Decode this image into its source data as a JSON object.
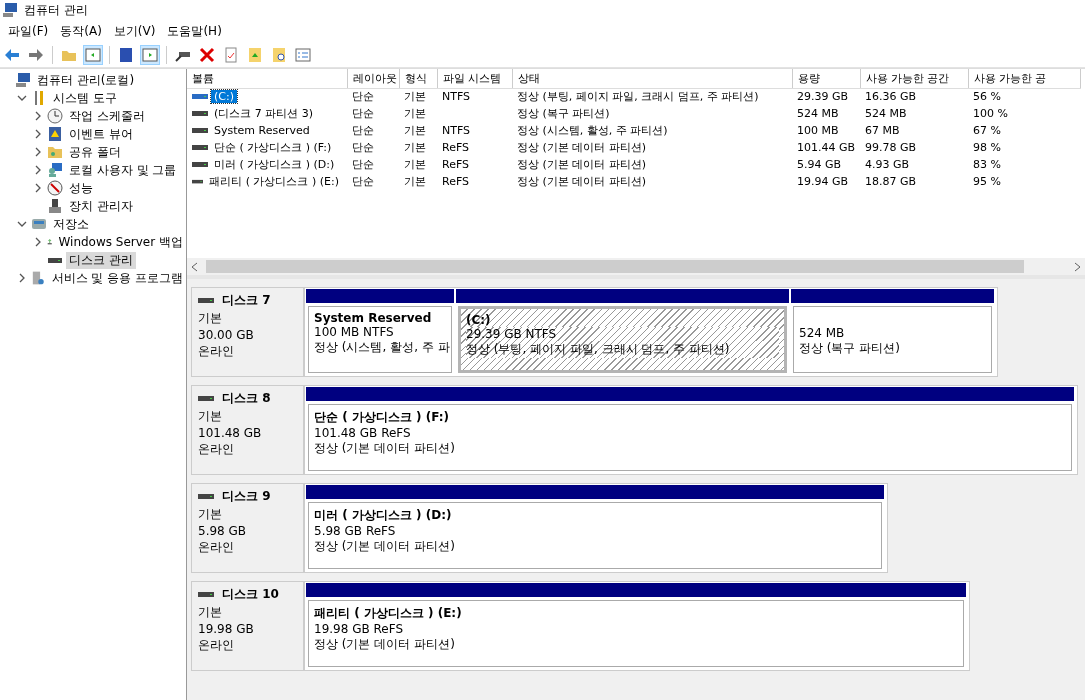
{
  "window": {
    "title": "컴퓨터 관리"
  },
  "menu": [
    "파일(F)",
    "동작(A)",
    "보기(V)",
    "도움말(H)"
  ],
  "tree": [
    {
      "label": "컴퓨터 관리(로컬)",
      "selected": false,
      "children": [
        {
          "label": "시스템 도구",
          "expanded": true,
          "selected": false,
          "children": [
            {
              "label": "작업 스케줄러",
              "expanded": false,
              "selected": false
            },
            {
              "label": "이벤트 뷰어",
              "expanded": false,
              "selected": false
            },
            {
              "label": "공유 폴더",
              "expanded": false,
              "selected": false
            },
            {
              "label": "로컬 사용자 및 그룹",
              "expanded": false,
              "selected": false
            },
            {
              "label": "성능",
              "expanded": false,
              "selected": false
            },
            {
              "label": "장치 관리자",
              "selected": false
            }
          ]
        },
        {
          "label": "저장소",
          "expanded": true,
          "selected": false,
          "children": [
            {
              "label": "Windows Server 백업",
              "expanded": false,
              "selected": false
            },
            {
              "label": "디스크 관리",
              "selected": true
            }
          ]
        },
        {
          "label": "서비스 및 응용 프로그램",
          "expanded": false,
          "selected": false
        }
      ]
    }
  ],
  "volume_table": {
    "columns": [
      "볼륨",
      "레이아웃",
      "형식",
      "파일 시스템",
      "상태",
      "용량",
      "사용 가능한 공간",
      "사용 가능한 공"
    ],
    "rows": [
      {
        "selected": true,
        "cells": [
          "(C:)",
          "단순",
          "기본",
          "NTFS",
          "정상 (부팅, 페이지 파일, 크래시 덤프, 주 파티션)",
          "29.39 GB",
          "16.36 GB",
          "56 %"
        ]
      },
      {
        "selected": false,
        "cells": [
          "(디스크 7 파티션 3)",
          "단순",
          "기본",
          "",
          "정상 (복구 파티션)",
          "524 MB",
          "524 MB",
          "100 %"
        ]
      },
      {
        "selected": false,
        "cells": [
          "System Reserved",
          "단순",
          "기본",
          "NTFS",
          "정상 (시스템, 활성, 주 파티션)",
          "100 MB",
          "67 MB",
          "67 %"
        ]
      },
      {
        "selected": false,
        "cells": [
          "단순 ( 가상디스크 ) (F:)",
          "단순",
          "기본",
          "ReFS",
          "정상 (기본 데이터 파티션)",
          "101.44 GB",
          "99.78 GB",
          "98 %"
        ]
      },
      {
        "selected": false,
        "cells": [
          "미러 ( 가상디스크 ) (D:)",
          "단순",
          "기본",
          "ReFS",
          "정상 (기본 데이터 파티션)",
          "5.94 GB",
          "4.93 GB",
          "83 %"
        ]
      },
      {
        "selected": false,
        "cells": [
          "패리티 ( 가상디스크 ) (E:)",
          "단순",
          "기본",
          "ReFS",
          "정상 (기본 데이터 파티션)",
          "19.94 GB",
          "18.87 GB",
          "95 %"
        ]
      }
    ]
  },
  "disks": [
    {
      "name": "디스크 7",
      "type": "기본",
      "size": "30.00 GB",
      "status": "온라인",
      "partitions": [
        {
          "title": "System Reserved",
          "size": "100 MB NTFS",
          "status": "정상 (시스템, 활성, 주 파",
          "selected": false
        },
        {
          "title": "(C:)",
          "size": "29.39 GB NTFS",
          "status": "정상 (부팅, 페이지 파일, 크래시 덤프, 주 파티션)",
          "selected": true
        },
        {
          "size": "524 MB",
          "status": "정상 (복구 파티션)",
          "selected": false
        }
      ]
    },
    {
      "name": "디스크 8",
      "type": "기본",
      "size": "101.48 GB",
      "status": "온라인",
      "partitions": [
        {
          "title": "단순 ( 가상디스크 )  (F:)",
          "size": "101.48 GB ReFS",
          "status": "정상 (기본 데이터 파티션)",
          "selected": false
        }
      ]
    },
    {
      "name": "디스크 9",
      "type": "기본",
      "size": "5.98 GB",
      "status": "온라인",
      "partitions": [
        {
          "title": "미러 ( 가상디스크 )  (D:)",
          "size": "5.98 GB ReFS",
          "status": "정상 (기본 데이터 파티션)",
          "selected": false
        }
      ]
    },
    {
      "name": "디스크 10",
      "type": "기본",
      "size": "19.98 GB",
      "status": "온라인",
      "partitions": [
        {
          "title": "패리티 ( 가상디스크 )  (E:)",
          "size": "19.98 GB ReFS",
          "status": "정상 (기본 데이터 파티션)",
          "selected": false
        }
      ]
    }
  ]
}
